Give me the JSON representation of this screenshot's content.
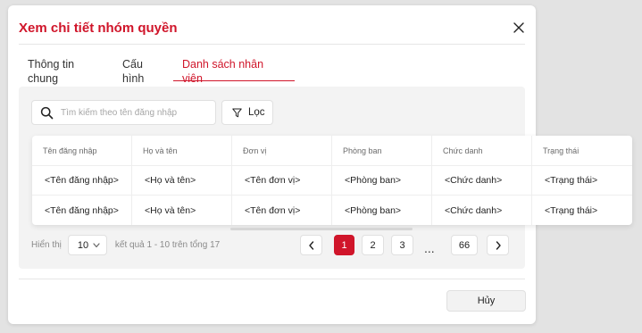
{
  "modal": {
    "title": "Xem chi tiết nhóm quyền",
    "tabs": [
      {
        "label": "Thông tin chung",
        "active": false
      },
      {
        "label": "Cấu hình",
        "active": false
      },
      {
        "label": "Danh sách nhân viên",
        "active": true
      }
    ]
  },
  "toolbar": {
    "search_placeholder": "Tìm kiếm theo tên đăng nhập",
    "filter_label": "Lọc"
  },
  "table": {
    "columns": [
      "Tên đăng nhập",
      "Họ và tên",
      "Đơn vị",
      "Phòng ban",
      "Chức danh",
      "Trạng thái"
    ],
    "rows": [
      [
        "<Tên đăng nhập>",
        "<Họ và tên>",
        "<Tên đơn vị>",
        "<Phòng ban>",
        "<Chức danh>",
        "<Trạng thái>"
      ],
      [
        "<Tên đăng nhập>",
        "<Họ và tên>",
        "<Tên đơn vị>",
        "<Phòng ban>",
        "<Chức danh>",
        "<Trạng thái>"
      ]
    ]
  },
  "pagination": {
    "show_label": "Hiển thị",
    "page_size": "10",
    "range_text": "kết quả 1 - 10 trên tổng 17",
    "pages": [
      "1",
      "2",
      "3",
      "66"
    ],
    "ellipsis": "...",
    "current_page": "1"
  },
  "footer": {
    "cancel_label": "Hủy"
  },
  "colors": {
    "accent": "#d0152a",
    "panel_bg": "#f3f3f3",
    "page_bg": "#e3e3e3"
  }
}
